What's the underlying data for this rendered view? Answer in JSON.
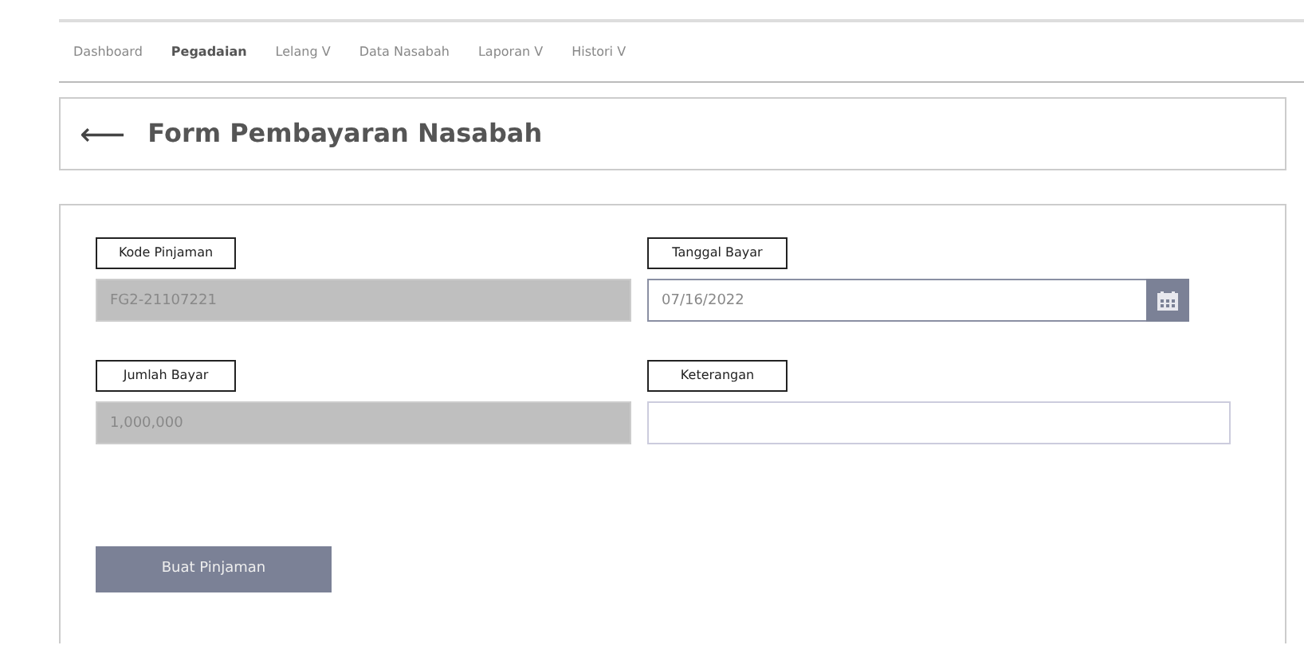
{
  "nav": [
    {
      "label": "Dashboard",
      "selected": false
    },
    {
      "label": "Pegadaian",
      "selected": true
    },
    {
      "label": "Lelang V",
      "selected": false
    },
    {
      "label": "Data Nasabah",
      "selected": false
    },
    {
      "label": "Laporan V",
      "selected": false
    },
    {
      "label": "Histori V",
      "selected": false
    }
  ],
  "header": {
    "back_icon": "⟵",
    "title": "Form Pembayaran Nasabah"
  },
  "fields": [
    {
      "label": "Kode Pinjaman",
      "kind": "text",
      "value": "FG2-21107221",
      "disabled": true
    },
    {
      "label": "Tanggal Bayar",
      "kind": "date",
      "value": "07/16/2022",
      "disabled": false
    },
    {
      "label": "Jumlah Bayar",
      "kind": "text",
      "value": "1,000,000",
      "disabled": true
    },
    {
      "label": "Keterangan",
      "kind": "text",
      "disabled": false
    }
  ],
  "submit": {
    "label": "Buat Pinjaman"
  }
}
